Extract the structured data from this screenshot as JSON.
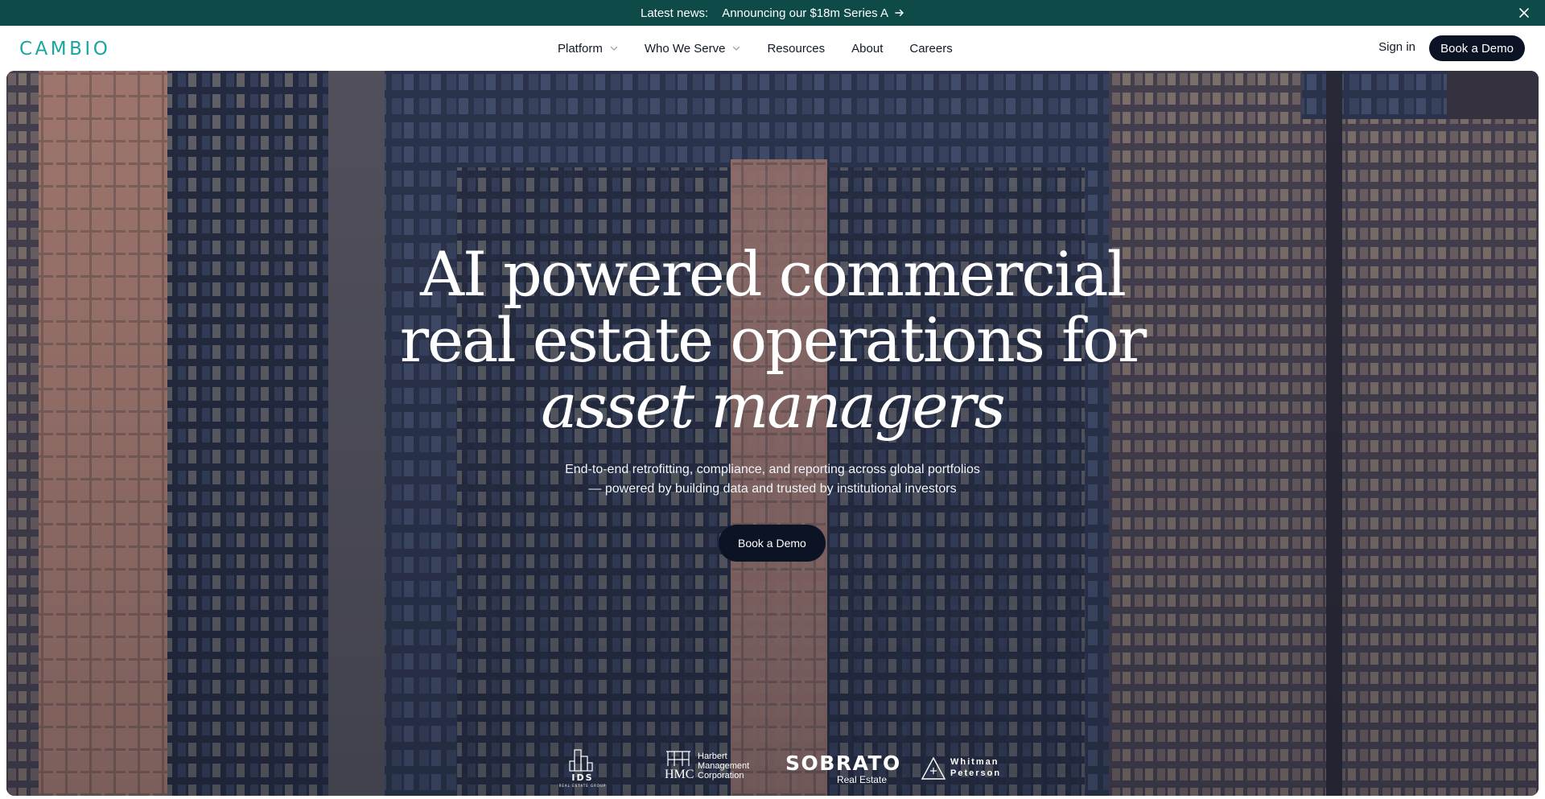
{
  "announcement": {
    "lead": "Latest news:",
    "link_text": "Announcing our $18m Series A",
    "arrow_icon": "arrow-right-icon",
    "close_icon": "close-icon"
  },
  "nav": {
    "logo": "CAMBIO",
    "items": [
      {
        "label": "Platform",
        "has_dropdown": true
      },
      {
        "label": "Who We Serve",
        "has_dropdown": true
      },
      {
        "label": "Resources",
        "has_dropdown": false
      },
      {
        "label": "About",
        "has_dropdown": false
      },
      {
        "label": "Careers",
        "has_dropdown": false
      }
    ],
    "sign_in": "Sign in",
    "cta": "Book a Demo"
  },
  "hero": {
    "line1": "AI powered commercial",
    "line2": "real estate operations for",
    "line3_italic": "asset managers",
    "sub_line1": "End-to-end retrofitting, compliance, and reporting across global portfolios",
    "sub_line2": "— powered by building data and trusted by institutional investors",
    "cta": "Book a Demo"
  },
  "clients": [
    {
      "id": "ids",
      "abbr": "IDS",
      "tagline": "REAL ESTATE GROUP"
    },
    {
      "id": "hmc",
      "abbr": "HMC",
      "name_lines": [
        "Harbert",
        "Management",
        "Corporation"
      ]
    },
    {
      "id": "sobrato",
      "name": "SOBRATO",
      "tagline": "Real Estate"
    },
    {
      "id": "whitman",
      "name_lines": [
        "Whitman",
        "Peterson"
      ]
    }
  ],
  "colors": {
    "announcement_bg": "#0d4a48",
    "logo": "#1aa6a0",
    "button_dark": "#0b1324"
  }
}
